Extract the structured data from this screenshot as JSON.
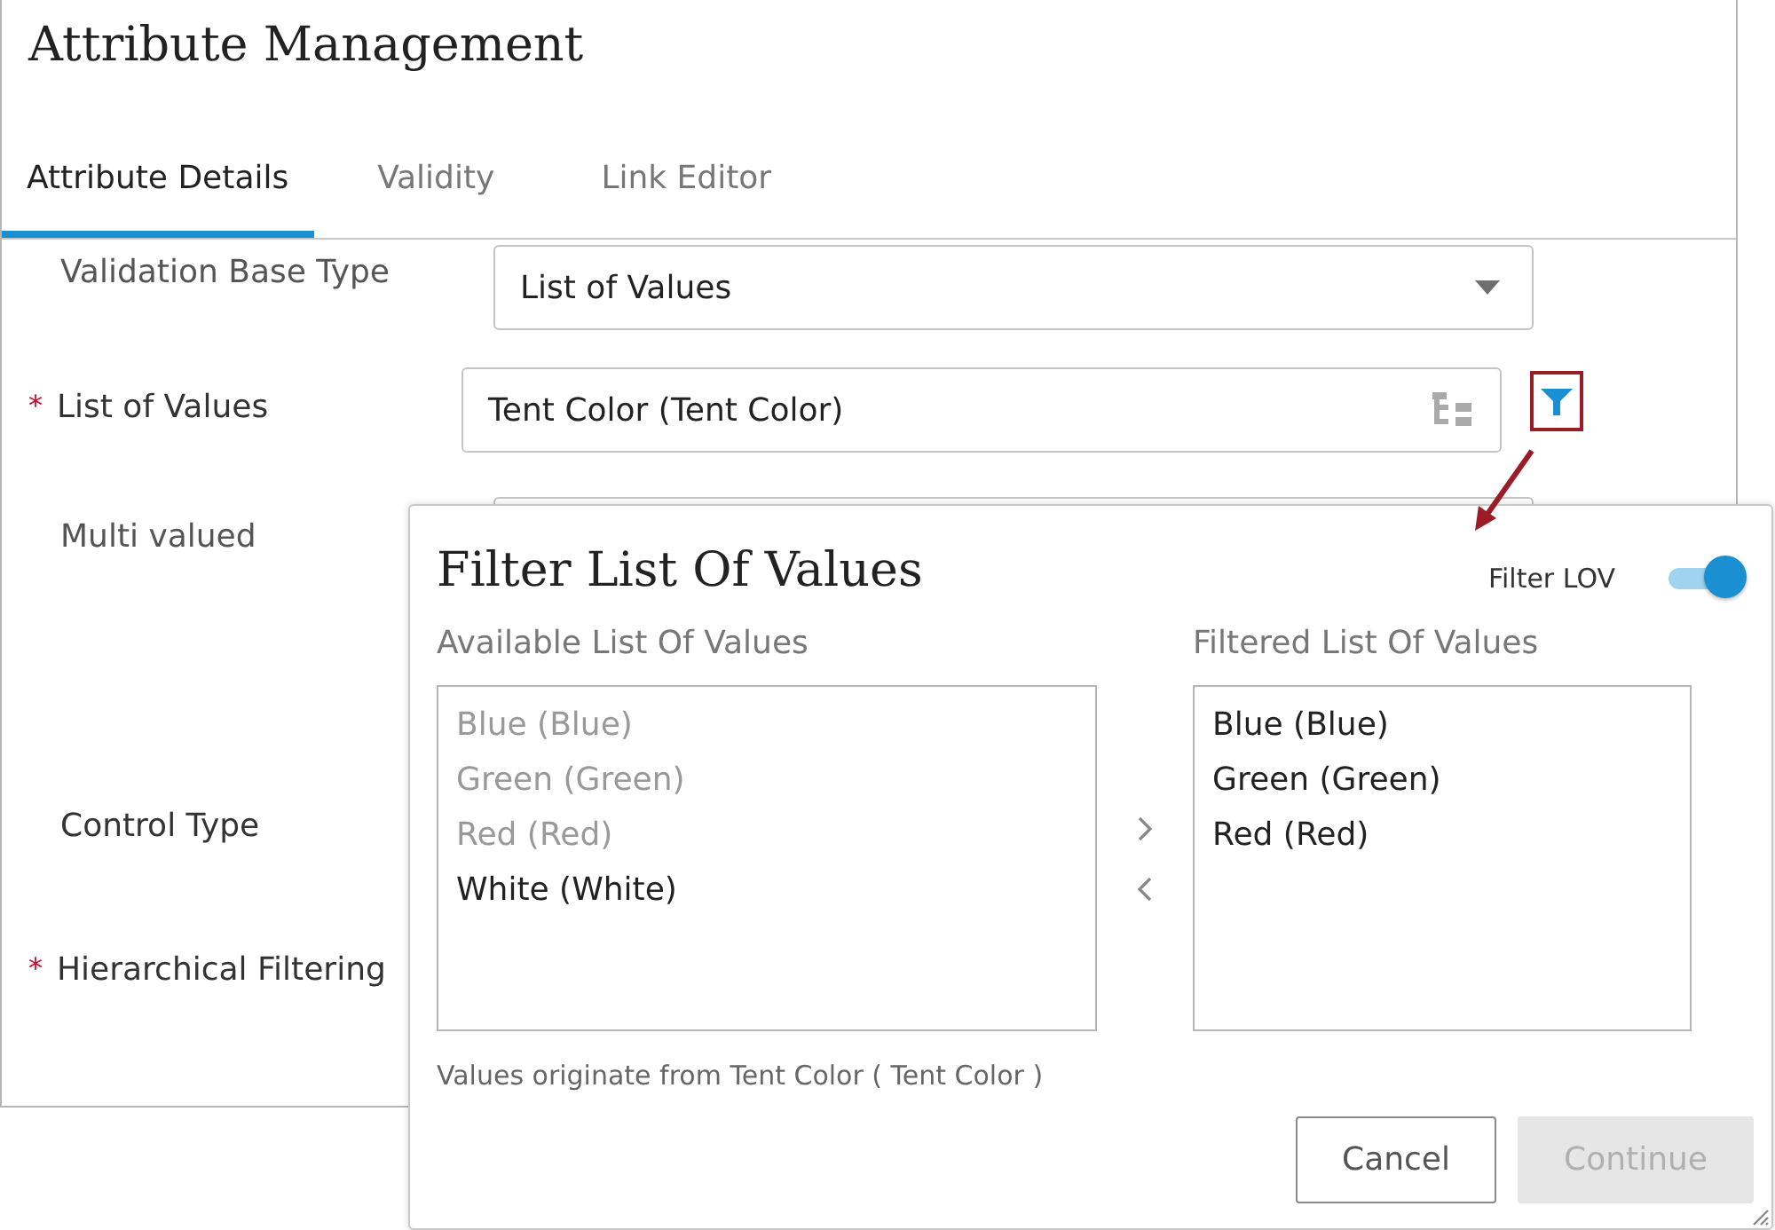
{
  "title": "Attribute Management",
  "tabs": [
    {
      "label": "Attribute Details",
      "selected": true
    },
    {
      "label": "Validity",
      "selected": false
    },
    {
      "label": "Link Editor",
      "selected": false
    }
  ],
  "form": [
    {
      "label": "Validation Base Type",
      "kind": "select",
      "value": "List of Values"
    },
    {
      "label": "List of Values",
      "required_mark": "*",
      "kind": "lookup",
      "value": "Tent Color (Tent Color)"
    },
    {
      "label": "Multi valued",
      "kind": "covered"
    },
    {
      "label": "Control Type",
      "kind": "plain"
    },
    {
      "label": "Hierarchical Filtering",
      "required_mark": "*",
      "kind": "plain"
    }
  ],
  "dialog": {
    "title": "Filter List Of Values",
    "toggle": {
      "label": "Filter LOV",
      "on": true
    },
    "available": {
      "label": "Available List Of Values",
      "items": [
        {
          "text": "Blue (Blue)",
          "disabled": true
        },
        {
          "text": "Green (Green)",
          "disabled": true
        },
        {
          "text": "Red (Red)",
          "disabled": true
        },
        {
          "text": "White (White)",
          "disabled": false
        }
      ]
    },
    "filtered": {
      "label": "Filtered List Of Values",
      "items": [
        {
          "text": "Blue (Blue)",
          "disabled": false
        },
        {
          "text": "Green (Green)",
          "disabled": false
        },
        {
          "text": "Red (Red)",
          "disabled": false
        }
      ]
    },
    "note": "Values originate from Tent Color ( Tent Color )",
    "buttons": [
      {
        "label": "Cancel",
        "disabled": false
      },
      {
        "label": "Continue",
        "disabled": true
      }
    ]
  }
}
